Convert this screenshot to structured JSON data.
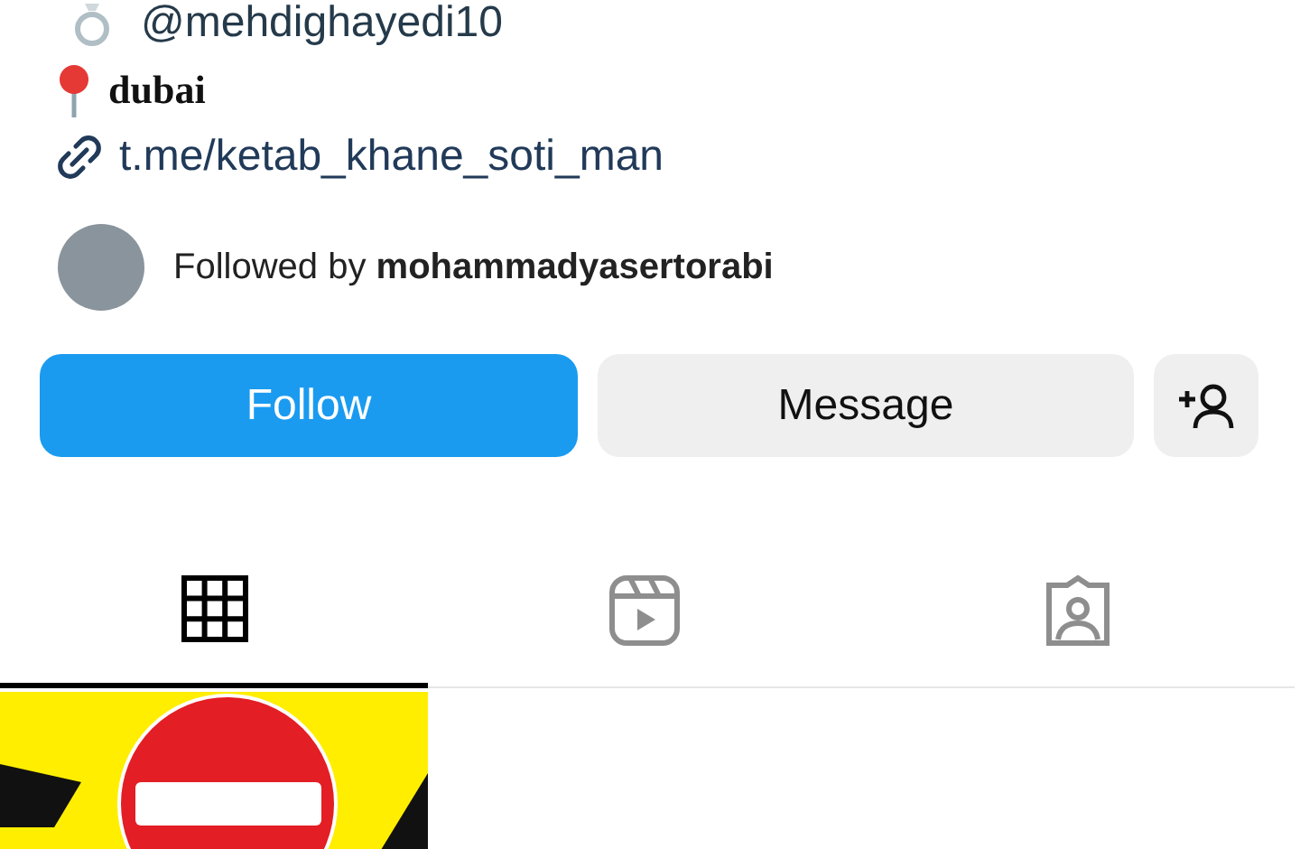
{
  "bio": {
    "handle": "@mehdighayedi10",
    "location": "dubai",
    "link": "t.me/ketab_khane_soti_man"
  },
  "followed_by": {
    "text": "Followed by **mohammadyasertorabi**"
  },
  "buttons": [
    {
      "kind": "primary",
      "label": "Follow"
    },
    {
      "kind": "secondary",
      "label": "Message"
    },
    {
      "kind": "add_person"
    }
  ],
  "tabs": [
    {
      "kind": "grid",
      "selected": true
    },
    {
      "kind": "reels",
      "selected": false
    },
    {
      "kind": "tagged",
      "selected": false
    }
  ]
}
